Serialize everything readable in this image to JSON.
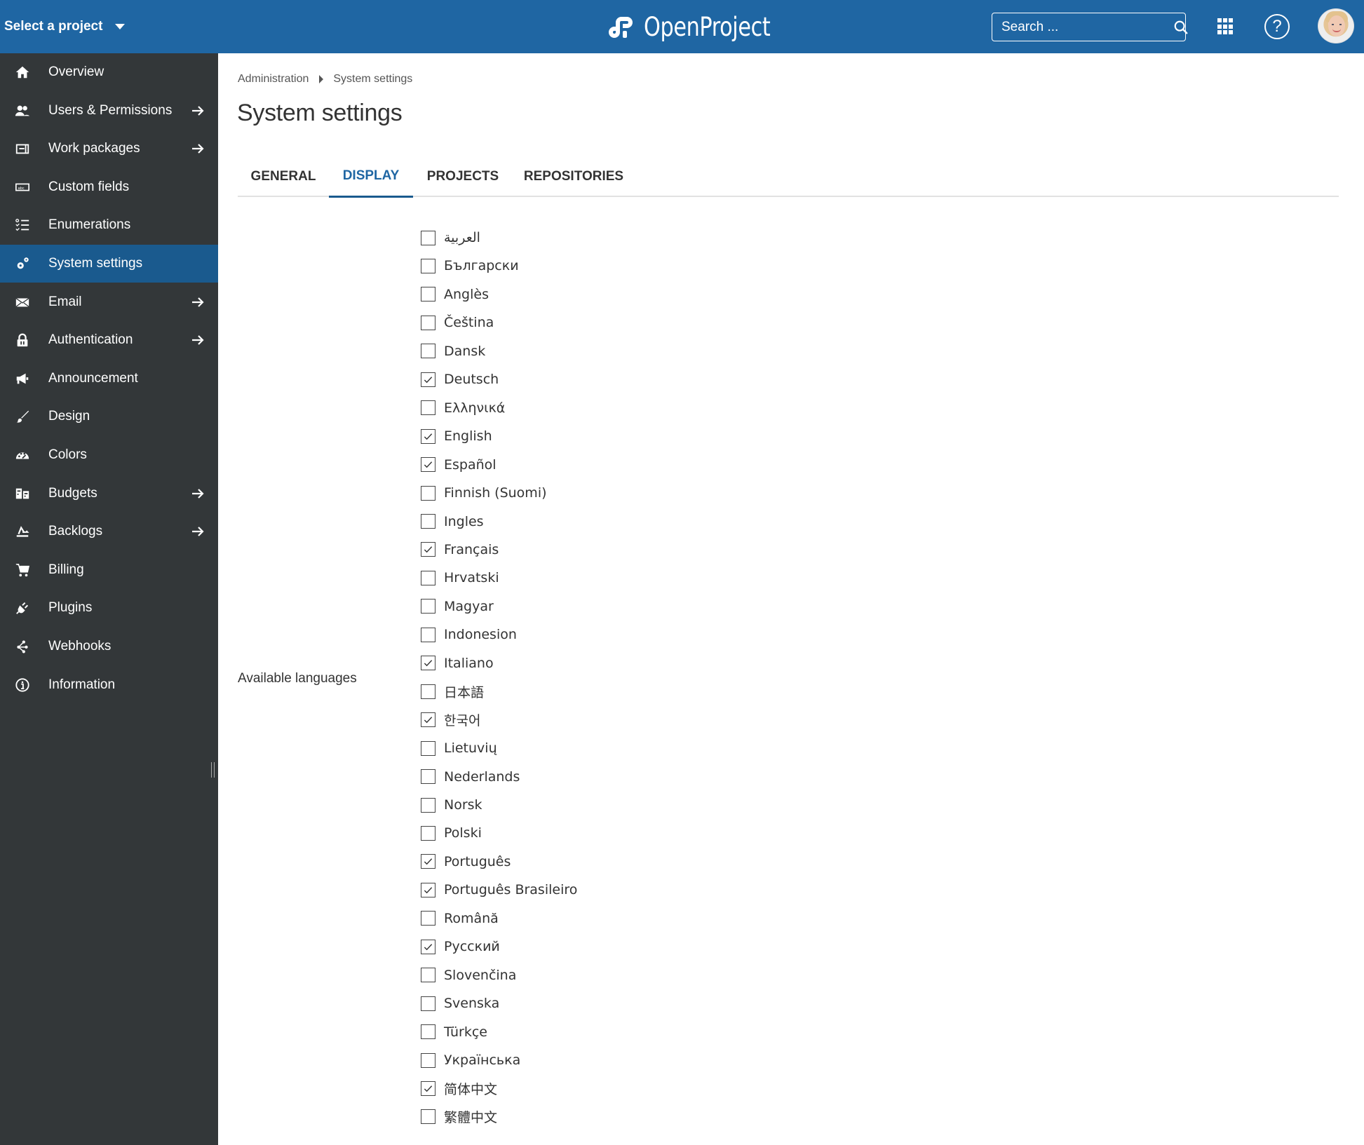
{
  "header": {
    "project_select": "Select a project",
    "logo_text": "OpenProject",
    "search_placeholder": "Search ...",
    "brand_color": "#1f66a3"
  },
  "sidebar": {
    "items": [
      {
        "label": "Overview",
        "icon": "home-icon",
        "arrow": false,
        "active": false
      },
      {
        "label": "Users & Permissions",
        "icon": "group-icon",
        "arrow": true,
        "active": false
      },
      {
        "label": "Work packages",
        "icon": "work-packages-icon",
        "arrow": true,
        "active": false
      },
      {
        "label": "Custom fields",
        "icon": "custom-fields-icon",
        "arrow": false,
        "active": false
      },
      {
        "label": "Enumerations",
        "icon": "enumerations-icon",
        "arrow": false,
        "active": false
      },
      {
        "label": "System settings",
        "icon": "gears-icon",
        "arrow": false,
        "active": true
      },
      {
        "label": "Email",
        "icon": "mail-icon",
        "arrow": true,
        "active": false
      },
      {
        "label": "Authentication",
        "icon": "lock-icon",
        "arrow": true,
        "active": false
      },
      {
        "label": "Announcement",
        "icon": "megaphone-icon",
        "arrow": false,
        "active": false
      },
      {
        "label": "Design",
        "icon": "brush-icon",
        "arrow": false,
        "active": false
      },
      {
        "label": "Colors",
        "icon": "palette-icon",
        "arrow": false,
        "active": false
      },
      {
        "label": "Budgets",
        "icon": "budget-icon",
        "arrow": true,
        "active": false
      },
      {
        "label": "Backlogs",
        "icon": "backlogs-icon",
        "arrow": true,
        "active": false
      },
      {
        "label": "Billing",
        "icon": "cart-icon",
        "arrow": false,
        "active": false
      },
      {
        "label": "Plugins",
        "icon": "plugin-icon",
        "arrow": false,
        "active": false
      },
      {
        "label": "Webhooks",
        "icon": "webhooks-icon",
        "arrow": false,
        "active": false
      },
      {
        "label": "Information",
        "icon": "info-icon",
        "arrow": false,
        "active": false
      }
    ]
  },
  "breadcrumb": {
    "items": [
      "Administration",
      "System settings"
    ]
  },
  "page": {
    "title": "System settings",
    "tabs": [
      {
        "label": "GENERAL",
        "active": false
      },
      {
        "label": "DISPLAY",
        "active": true
      },
      {
        "label": "PROJECTS",
        "active": false
      },
      {
        "label": "REPOSITORIES",
        "active": false
      }
    ]
  },
  "languages": {
    "label": "Available languages",
    "options": [
      {
        "name": "العربية",
        "checked": false
      },
      {
        "name": "Български",
        "checked": false
      },
      {
        "name": "Anglès",
        "checked": false
      },
      {
        "name": "Čeština",
        "checked": false
      },
      {
        "name": "Dansk",
        "checked": false
      },
      {
        "name": "Deutsch",
        "checked": true
      },
      {
        "name": "Ελληνικά",
        "checked": false
      },
      {
        "name": "English",
        "checked": true
      },
      {
        "name": "Español",
        "checked": true
      },
      {
        "name": "Finnish (Suomi)",
        "checked": false
      },
      {
        "name": "Ingles",
        "checked": false
      },
      {
        "name": "Français",
        "checked": true
      },
      {
        "name": "Hrvatski",
        "checked": false
      },
      {
        "name": "Magyar",
        "checked": false
      },
      {
        "name": "Indonesion",
        "checked": false
      },
      {
        "name": "Italiano",
        "checked": true
      },
      {
        "name": "日本語",
        "checked": false
      },
      {
        "name": "한국어",
        "checked": true
      },
      {
        "name": "Lietuvių",
        "checked": false
      },
      {
        "name": "Nederlands",
        "checked": false
      },
      {
        "name": "Norsk",
        "checked": false
      },
      {
        "name": "Polski",
        "checked": false
      },
      {
        "name": "Português",
        "checked": true
      },
      {
        "name": "Português Brasileiro",
        "checked": true
      },
      {
        "name": "Română",
        "checked": false
      },
      {
        "name": "Русский",
        "checked": true
      },
      {
        "name": "Slovenčina",
        "checked": false
      },
      {
        "name": "Svenska",
        "checked": false
      },
      {
        "name": "Türkçe",
        "checked": false
      },
      {
        "name": "Українська",
        "checked": false
      },
      {
        "name": "简体中文",
        "checked": true
      },
      {
        "name": "繁體中文",
        "checked": false
      }
    ]
  }
}
